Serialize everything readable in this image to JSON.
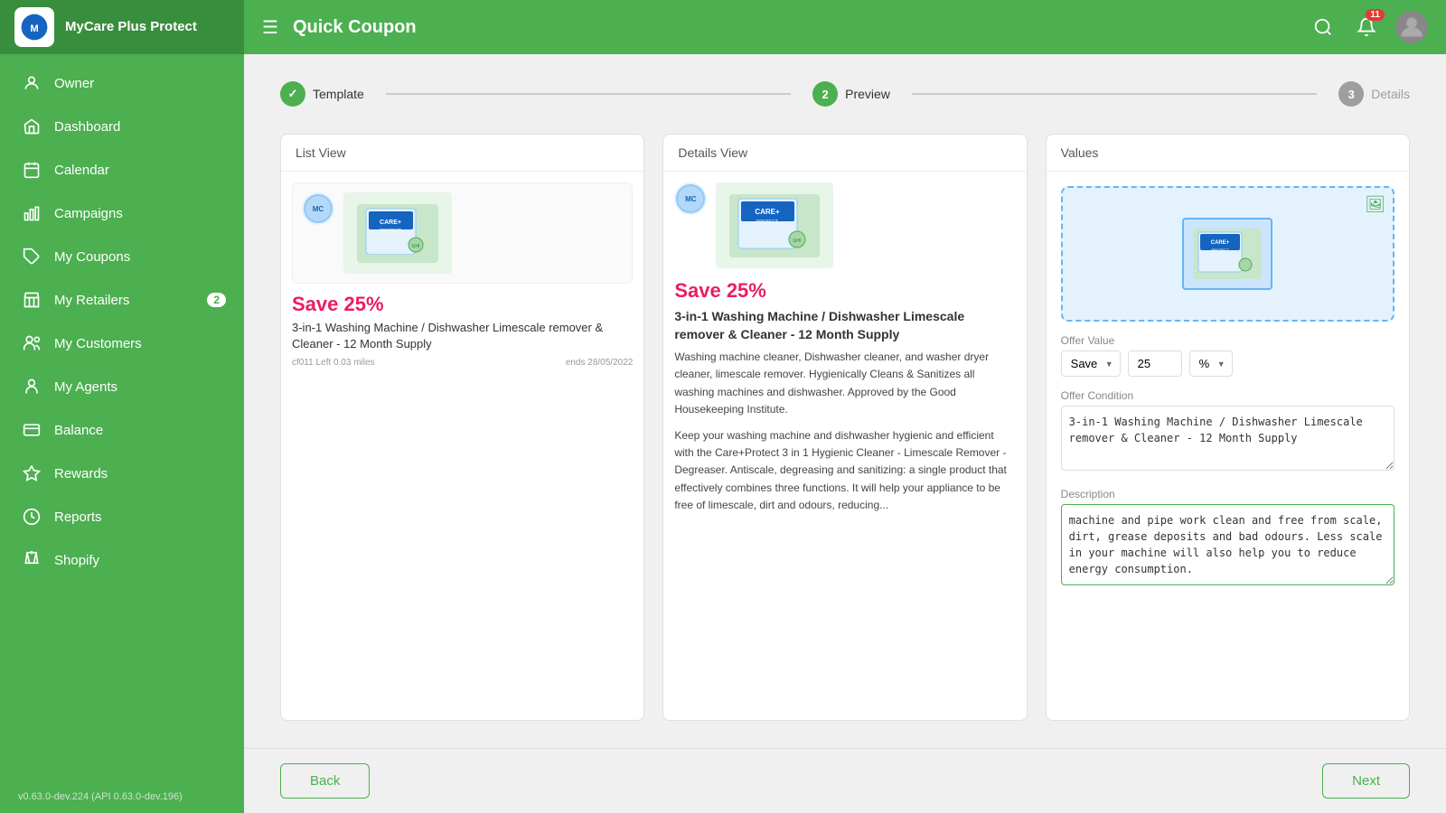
{
  "app": {
    "name": "MyCare Plus Protect",
    "version": "v0.63.0-dev.224 (API 0.63.0-dev.196)"
  },
  "sidebar": {
    "items": [
      {
        "id": "owner",
        "label": "Owner",
        "icon": "user-icon"
      },
      {
        "id": "dashboard",
        "label": "Dashboard",
        "icon": "home-icon"
      },
      {
        "id": "calendar",
        "label": "Calendar",
        "icon": "calendar-icon"
      },
      {
        "id": "campaigns",
        "label": "Campaigns",
        "icon": "bar-chart-icon"
      },
      {
        "id": "my-coupons",
        "label": "My Coupons",
        "icon": "tag-icon"
      },
      {
        "id": "my-retailers",
        "label": "My Retailers",
        "icon": "store-icon",
        "badge": "2"
      },
      {
        "id": "my-customers",
        "label": "My Customers",
        "icon": "users-icon"
      },
      {
        "id": "my-agents",
        "label": "My Agents",
        "icon": "agent-icon"
      },
      {
        "id": "balance",
        "label": "Balance",
        "icon": "balance-icon"
      },
      {
        "id": "rewards",
        "label": "Rewards",
        "icon": "rewards-icon"
      },
      {
        "id": "reports",
        "label": "Reports",
        "icon": "reports-icon"
      },
      {
        "id": "shopify",
        "label": "Shopify",
        "icon": "shopify-icon"
      }
    ]
  },
  "topbar": {
    "title": "Quick Coupon",
    "notifications_count": "11"
  },
  "stepper": {
    "steps": [
      {
        "number": "✓",
        "label": "Template",
        "state": "active"
      },
      {
        "number": "2",
        "label": "Preview",
        "state": "active"
      },
      {
        "number": "3",
        "label": "Details",
        "state": "inactive"
      }
    ]
  },
  "list_view": {
    "header": "List View",
    "save_text": "Save 25%",
    "product_title": "3-in-1 Washing Machine / Dishwasher Limescale remover & Cleaner - 12 Month Supply",
    "meta_left": "cf011  Left  0.03 miles",
    "meta_right": "ends 28/05/2022"
  },
  "details_view": {
    "header": "Details View",
    "save_text": "Save 25%",
    "product_title": "3-in-1 Washing Machine / Dishwasher Limescale remover & Cleaner - 12 Month Supply",
    "description_1": "Washing machine cleaner, Dishwasher cleaner, and washer dryer cleaner, limescale remover. Hygienically Cleans & Sanitizes all washing machines and dishwasher. Approved by the Good Housekeeping Institute.",
    "description_2": "Keep your washing machine and dishwasher hygienic and efficient with the Care+Protect 3 in 1 Hygienic Cleaner - Limescale Remover - Degreaser. Antiscale, degreasing and sanitizing: a single product that effectively combines three functions. It will help your appliance to be free of limescale, dirt and odours, reducing..."
  },
  "values": {
    "header": "Values",
    "offer_value_label": "Offer Value",
    "offer_type": "Save",
    "offer_amount": "25",
    "offer_unit": "%",
    "offer_condition_label": "Offer Condition",
    "offer_condition_value": "3-in-1 Washing Machine / Dishwasher Limescale remover & Cleaner - 12 Month Supply",
    "description_label": "Description",
    "description_value": "machine and pipe work clean and free from scale, dirt, grease deposits and bad odours. Less scale in your machine will also help you to reduce energy consumption."
  },
  "buttons": {
    "back": "Back",
    "next": "Next"
  }
}
